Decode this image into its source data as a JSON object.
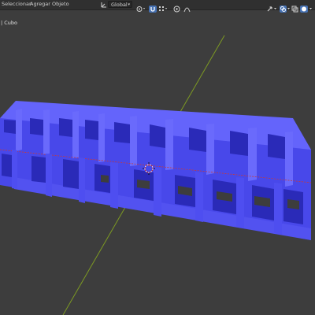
{
  "header": {
    "menus": [
      "Seleccionar",
      "Agregar",
      "Objeto"
    ],
    "transform_orientation": "Global"
  },
  "viewport": {
    "object_label": "| Cubo"
  },
  "icons": {
    "orientation": "orientation-axes-icon",
    "pivot": "pivot-point-icon",
    "snap": "snap-magnet-icon",
    "snap_target": "snap-increment-icon",
    "proportional": "proportional-editing-icon",
    "falloff": "falloff-curve-icon",
    "gizmo": "gizmo-arrows-icon",
    "overlays": "overlays-icon",
    "xray": "xray-icon",
    "shading": "viewport-shading-icon"
  },
  "colors": {
    "viewport_bg": "#3d3d3d",
    "header_bg": "#303030",
    "mesh_front": "#4848ea",
    "mesh_top": "#6464fb",
    "mesh_dark": "#2626b2",
    "y_axis": "#7d9a23",
    "x_axis": "#c83a3a"
  }
}
